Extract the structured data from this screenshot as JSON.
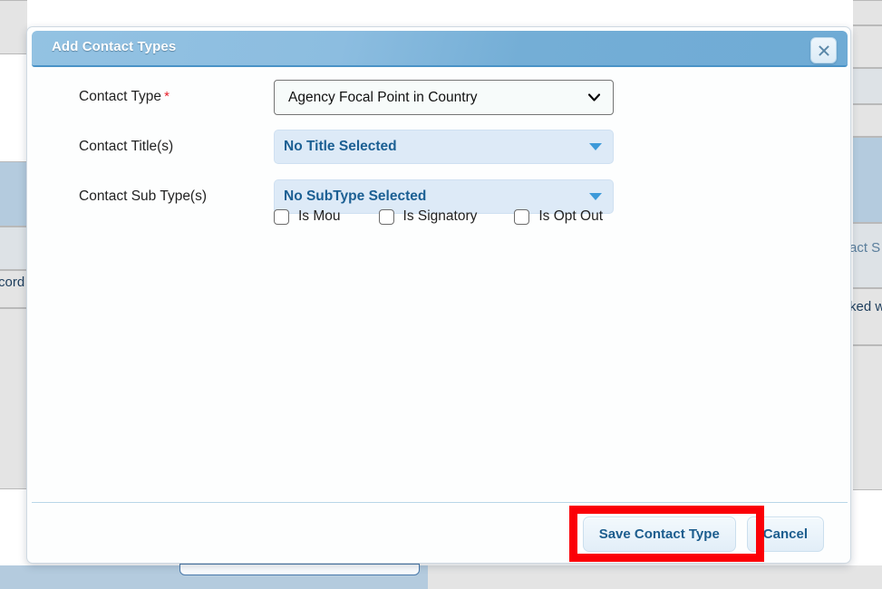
{
  "dialog": {
    "title": "Add Contact Types",
    "close_icon": "close-x-icon",
    "fields": [
      {
        "label": "Contact Type",
        "required": true,
        "required_marker": "*",
        "control": "native-select",
        "value": "Agency Focal Point in Country",
        "icon": "chevron-down-icon"
      },
      {
        "label": "Contact Title(s)",
        "required": false,
        "required_marker": "",
        "control": "multi-select",
        "value": "No Title Selected",
        "icon": "triangle-down-icon"
      },
      {
        "label": "Contact Sub Type(s)",
        "required": false,
        "required_marker": "",
        "control": "multi-select",
        "value": "No SubType Selected",
        "icon": "triangle-down-icon"
      }
    ],
    "checkboxes": [
      {
        "label": "Is Mou",
        "checked": false
      },
      {
        "label": "Is Signatory",
        "checked": false
      },
      {
        "label": "Is Opt Out",
        "checked": false
      }
    ],
    "footer": {
      "save_label": "Save Contact Type",
      "cancel_label": "Cancel"
    }
  },
  "annotation": {
    "color": "#fb0007",
    "target": "save-contact-type-button"
  },
  "background": {
    "left_text": "cord",
    "right_header_text": "act S",
    "right_cell_text": "ked w"
  },
  "colors": {
    "titlebar_blue": "#74aed6",
    "accent_blue": "#1b5f93",
    "select_fill": "#ddeaf7",
    "required_red": "#e8212c",
    "annotation_red": "#fb0007",
    "row_selected": "#b4cbde"
  }
}
